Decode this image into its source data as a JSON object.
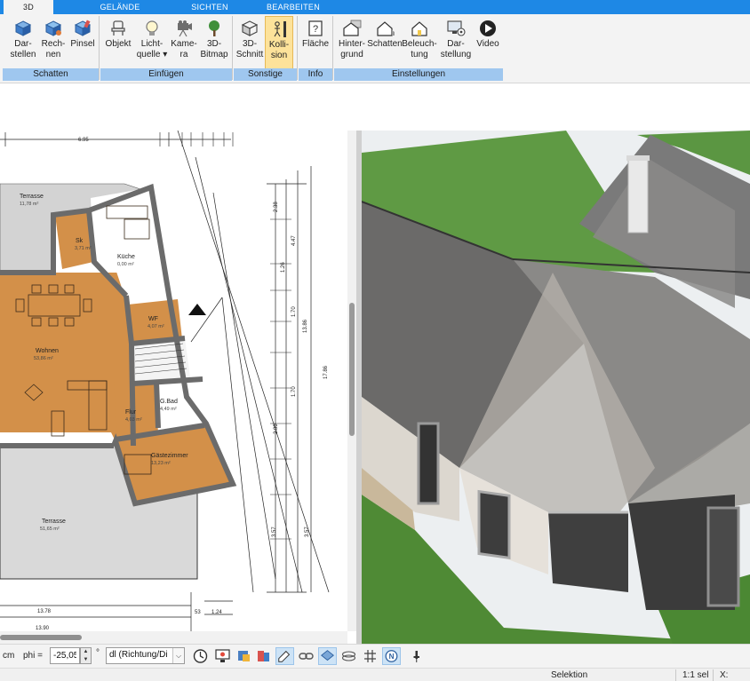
{
  "tabs": [
    {
      "label": "3D",
      "active": true
    },
    {
      "label": "GELÄNDE",
      "active": false
    },
    {
      "label": "SICHTEN",
      "active": false
    },
    {
      "label": "BEARBEITEN",
      "active": false
    }
  ],
  "ribbon": {
    "buttons": {
      "darstellen": {
        "line1": "Dar-",
        "line2": "stellen",
        "icon": "cube-render-icon"
      },
      "rechnen": {
        "line1": "Rech-",
        "line2": "nen",
        "icon": "cube-calc-icon"
      },
      "pinsel": {
        "line1": "Pinsel",
        "line2": "",
        "icon": "brush-icon"
      },
      "objekt": {
        "line1": "Objekt",
        "line2": "",
        "icon": "chair-icon"
      },
      "lichtquelle": {
        "line1": "Licht-",
        "line2": "quelle ▾",
        "icon": "lightbulb-icon"
      },
      "kamera": {
        "line1": "Kame-",
        "line2": "ra",
        "icon": "camera-icon"
      },
      "bitmap": {
        "line1": "3D-",
        "line2": "Bitmap",
        "icon": "tree-icon"
      },
      "schnitt": {
        "line1": "3D-",
        "line2": "Schnitt",
        "icon": "section-cube-icon"
      },
      "kollision": {
        "line1": "Kolli-",
        "line2": "sion",
        "icon": "person-collision-icon"
      },
      "flaeche": {
        "line1": "Fläche",
        "line2": "",
        "icon": "area-question-icon"
      },
      "hintergrund": {
        "line1": "Hinter-",
        "line2": "grund",
        "icon": "house-background-icon"
      },
      "schatten2": {
        "line1": "Schatten",
        "line2": "",
        "icon": "house-shadow-icon"
      },
      "beleuchtung": {
        "line1": "Beleuch-",
        "line2": "tung",
        "icon": "house-light-icon"
      },
      "darstellung": {
        "line1": "Dar-",
        "line2": "stellung",
        "icon": "monitor-gear-icon"
      },
      "video": {
        "line1": "Video",
        "line2": "",
        "icon": "play-icon"
      }
    },
    "groups": {
      "schatten": "Schatten",
      "einfuegen": "Einfügen",
      "sonstige": "Sonstige",
      "info": "Info",
      "einstellungen": "Einstellungen"
    }
  },
  "plan": {
    "dims": {
      "top_695": "6.95",
      "left_1378": "13.78",
      "left_1390": "13.90",
      "right_1786": "17.86",
      "right_1386": "13.86",
      "right_357a": "3.57",
      "right_357b": "3.57",
      "right_447": "4.47",
      "right_238": "2.38",
      "right_289": "2.89",
      "right_170a": "1.70",
      "right_170b": "1.70",
      "right_126": "1.26",
      "bot_53": "53",
      "bot_124": "1.24"
    },
    "rooms": [
      {
        "key": "terrasse_top",
        "name": "Terrasse",
        "area": "11,78 m²"
      },
      {
        "key": "sk",
        "name": "Sk",
        "area": "3,71 m²"
      },
      {
        "key": "kueche",
        "name": "Küche",
        "area": "0,00 m²"
      },
      {
        "key": "wf",
        "name": "WF",
        "area": "4,07 m²"
      },
      {
        "key": "wohnen",
        "name": "Wohnen",
        "area": "53,86 m²"
      },
      {
        "key": "flur",
        "name": "Flur",
        "area": "4,03 m²"
      },
      {
        "key": "gbad",
        "name": "G.Bad",
        "area": "4,49 m²"
      },
      {
        "key": "gaeste",
        "name": "Gästezimmer",
        "area": "13,23 m²"
      },
      {
        "key": "terrasse_bottom",
        "name": "Terrasse",
        "area": "51,65 m²"
      }
    ]
  },
  "toolbar": {
    "unit": "cm",
    "phi_label": "phi =",
    "phi_value": "-25,05",
    "degree": "°",
    "direction_select": "dl (Richtung/Di",
    "icons": [
      "clock-icon",
      "render-screen-icon",
      "color-bucket-icon",
      "paint-icon",
      "pencil-tool-icon",
      "link-icon",
      "layer-icon",
      "wireframe-icon",
      "grid-icon",
      "north-icon",
      "pin-icon"
    ]
  },
  "status": {
    "mode": "Selektion",
    "scale": "1:1 sel",
    "coord_label": "X:"
  },
  "colors": {
    "tab_blue": "#1e88e5",
    "group_bar": "#9fc7ef",
    "active_button": "#fde29a",
    "wood_floor": "#d39049",
    "wall": "#6b6b6b",
    "grass": "#4f8a35",
    "roof_green": "#5f9a44"
  }
}
